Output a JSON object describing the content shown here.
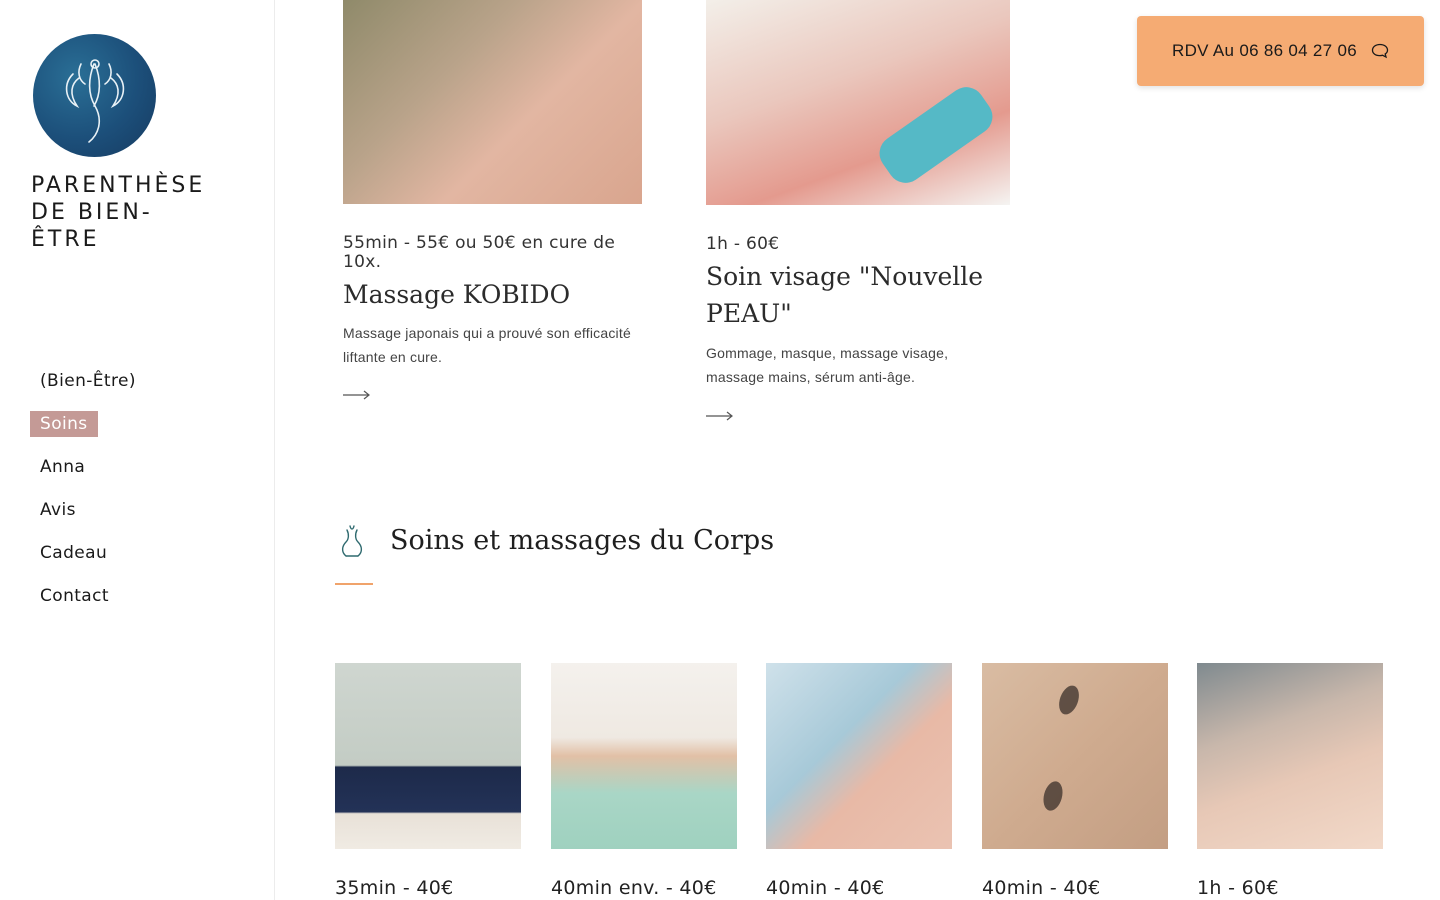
{
  "brand": {
    "name": "PARENTHÈSE\nDE BIEN-\nÊTRE"
  },
  "nav": {
    "items": [
      {
        "label": "(Bien-Être)"
      },
      {
        "label": "Soins",
        "active": true
      },
      {
        "label": "Anna"
      },
      {
        "label": "Avis"
      },
      {
        "label": "Cadeau"
      },
      {
        "label": "Contact"
      }
    ]
  },
  "cta": {
    "label": "RDV Au 06 86 04 27 06",
    "icon": "speech-bubble-icon"
  },
  "face_cards": [
    {
      "meta": "55min - 55€ ou 50€ en cure de 10x.",
      "title": "Massage KOBIDO",
      "description": "Massage japonais qui a prouvé son efficacité liftante en cure."
    },
    {
      "meta": "1h - 60€",
      "title": "Soin visage \"Nouvelle PEAU\"",
      "description": "Gommage, masque, massage visage, massage mains, sérum anti-âge."
    }
  ],
  "body_section": {
    "title": "Soins et massages du Corps",
    "icon": "body-silhouette-icon",
    "cards": [
      {
        "price": "35min - 40€"
      },
      {
        "price": "40min env. - 40€"
      },
      {
        "price": "40min - 40€"
      },
      {
        "price": "40min - 40€"
      },
      {
        "price": "1h - 60€"
      }
    ]
  },
  "colors": {
    "accent": "#f5ab73",
    "nav_active": "#c49a96",
    "logo": "#1c4f7a"
  }
}
